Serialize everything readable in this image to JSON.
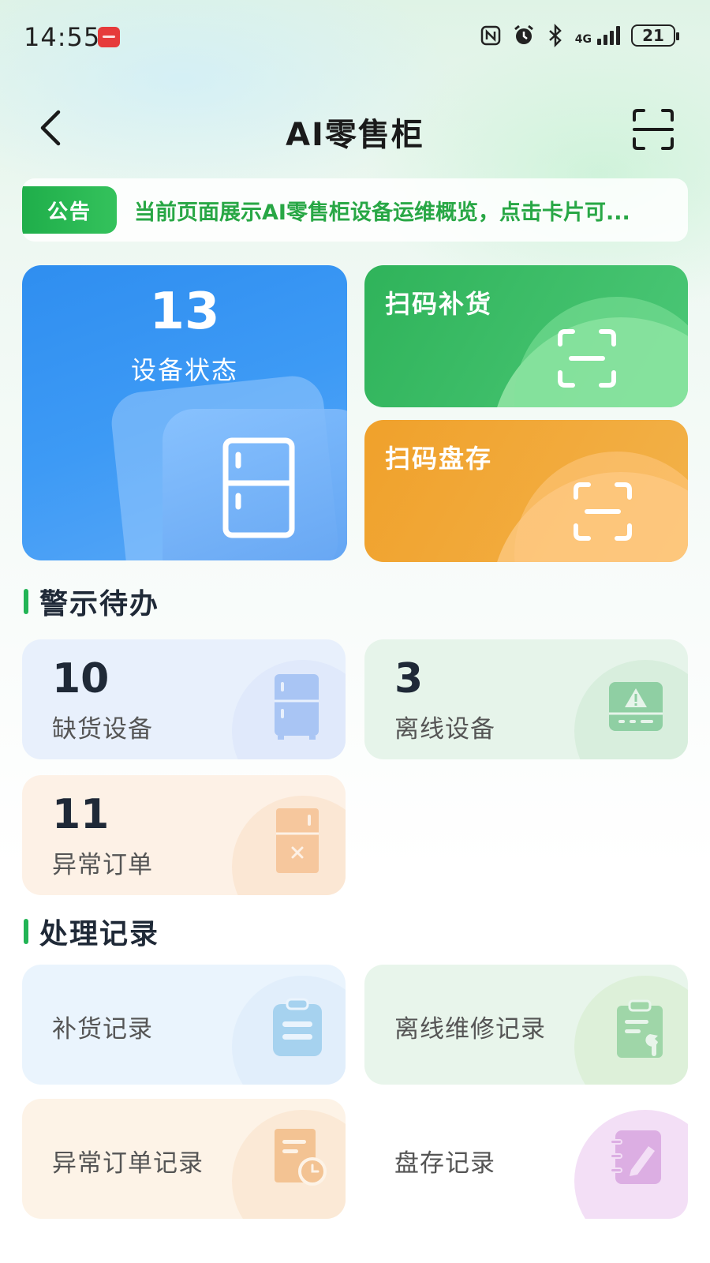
{
  "status_bar": {
    "time": "14:55",
    "network": "4G",
    "battery": "21"
  },
  "header": {
    "title": "AI零售柜"
  },
  "notice": {
    "tag": "公告",
    "text": "当前页面展示AI零售柜设备运维概览，点击卡片可..."
  },
  "top_cards": {
    "device_status": {
      "count": "13",
      "label": "设备状态"
    },
    "scan_replenish": {
      "label": "扫码补货"
    },
    "scan_inventory": {
      "label": "扫码盘存"
    }
  },
  "alerts": {
    "title": "警示待办",
    "items": [
      {
        "count": "10",
        "label": "缺货设备"
      },
      {
        "count": "3",
        "label": "离线设备"
      },
      {
        "count": "11",
        "label": "异常订单"
      }
    ]
  },
  "records": {
    "title": "处理记录",
    "items": [
      {
        "label": "补货记录"
      },
      {
        "label": "离线维修记录"
      },
      {
        "label": "异常订单记录"
      },
      {
        "label": "盘存记录"
      }
    ]
  },
  "colors": {
    "accent_green": "#22b455",
    "device_blue": "#2f8ef0",
    "replenish_green": "#2fb35a",
    "inventory_orange": "#f0a12b"
  },
  "icons": {
    "back": "chevron-left-icon",
    "scan": "scan-icon",
    "device": "fridge-icon",
    "offline": "warning-terminal-icon",
    "abnormal": "fridge-x-icon",
    "replenish_record": "clipboard-icon",
    "repair_record": "clipboard-wrench-icon",
    "abnormal_record": "document-clock-icon",
    "inventory_record": "notebook-pen-icon"
  }
}
